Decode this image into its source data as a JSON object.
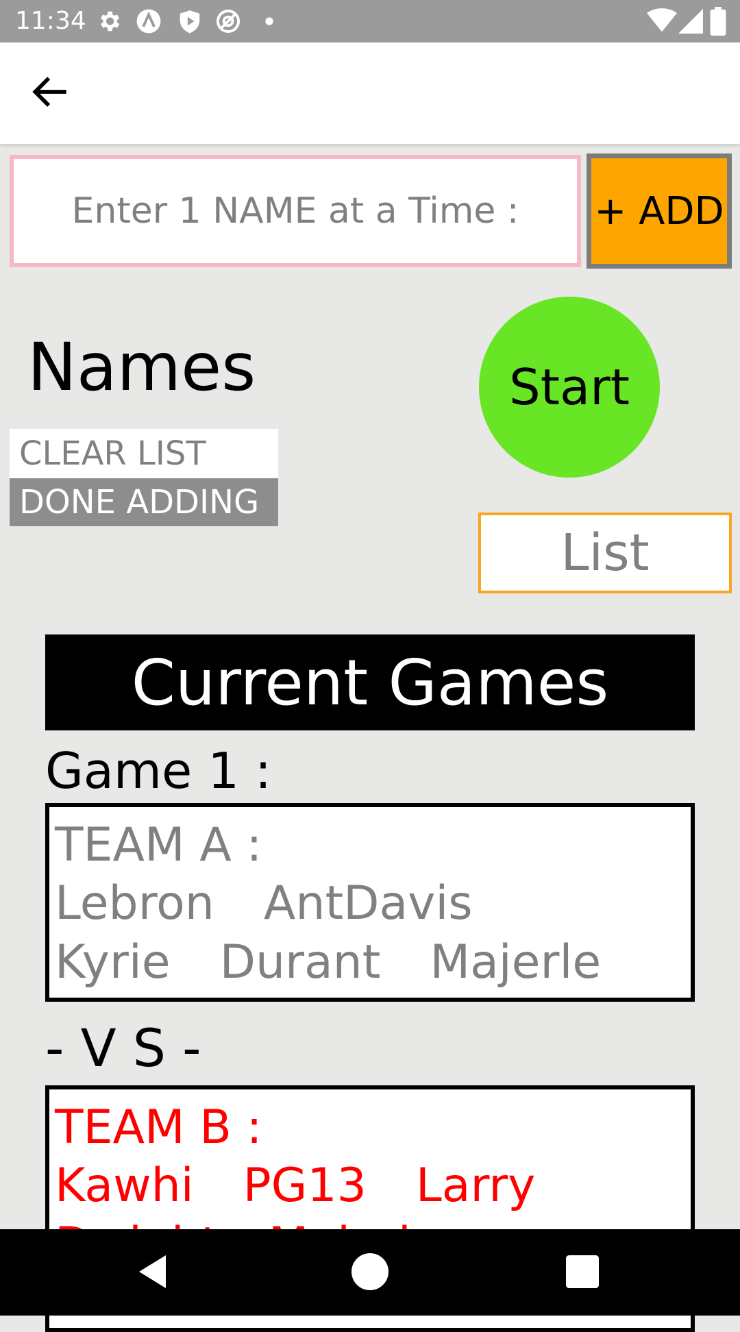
{
  "status_bar": {
    "time": "11:34",
    "icons": [
      "gear-icon",
      "a-circle-icon",
      "shield-play-icon",
      "at-circle-icon",
      "dot-icon",
      "wifi-icon",
      "signal-icon",
      "battery-icon"
    ]
  },
  "app_bar": {
    "back_icon": "arrow-left-icon"
  },
  "input": {
    "placeholder": "Enter 1 NAME at a Time :",
    "value": ""
  },
  "add_button": {
    "label": "+ ADD"
  },
  "names": {
    "title": "Names",
    "clear_list_label": "CLEAR LIST",
    "done_adding_label": "DONE ADDING"
  },
  "start_button": {
    "label": "Start"
  },
  "list_button": {
    "label": "List"
  },
  "games": {
    "title": "Current Games",
    "game_label": "Game 1 :",
    "vs_label": "- V S -",
    "team_a": {
      "title": "TEAM A :",
      "players": [
        "Lebron",
        "AntDavis",
        "Kyrie",
        "Durant",
        "Majerle"
      ]
    },
    "team_b": {
      "title": "TEAM B :",
      "players": [
        "Kawhi",
        "PG13",
        "Larry",
        "Dwight",
        "Majerle"
      ]
    }
  },
  "nav_bar": {
    "icons": [
      "back-triangle-icon",
      "home-circle-icon",
      "recents-square-icon"
    ]
  },
  "colors": {
    "add_button": "#ffa500",
    "start_button": "#68e626",
    "list_border": "#f5a623",
    "input_border": "#f5b8c4",
    "team_b_text": "#ff0000",
    "background": "#e8e8e6"
  }
}
